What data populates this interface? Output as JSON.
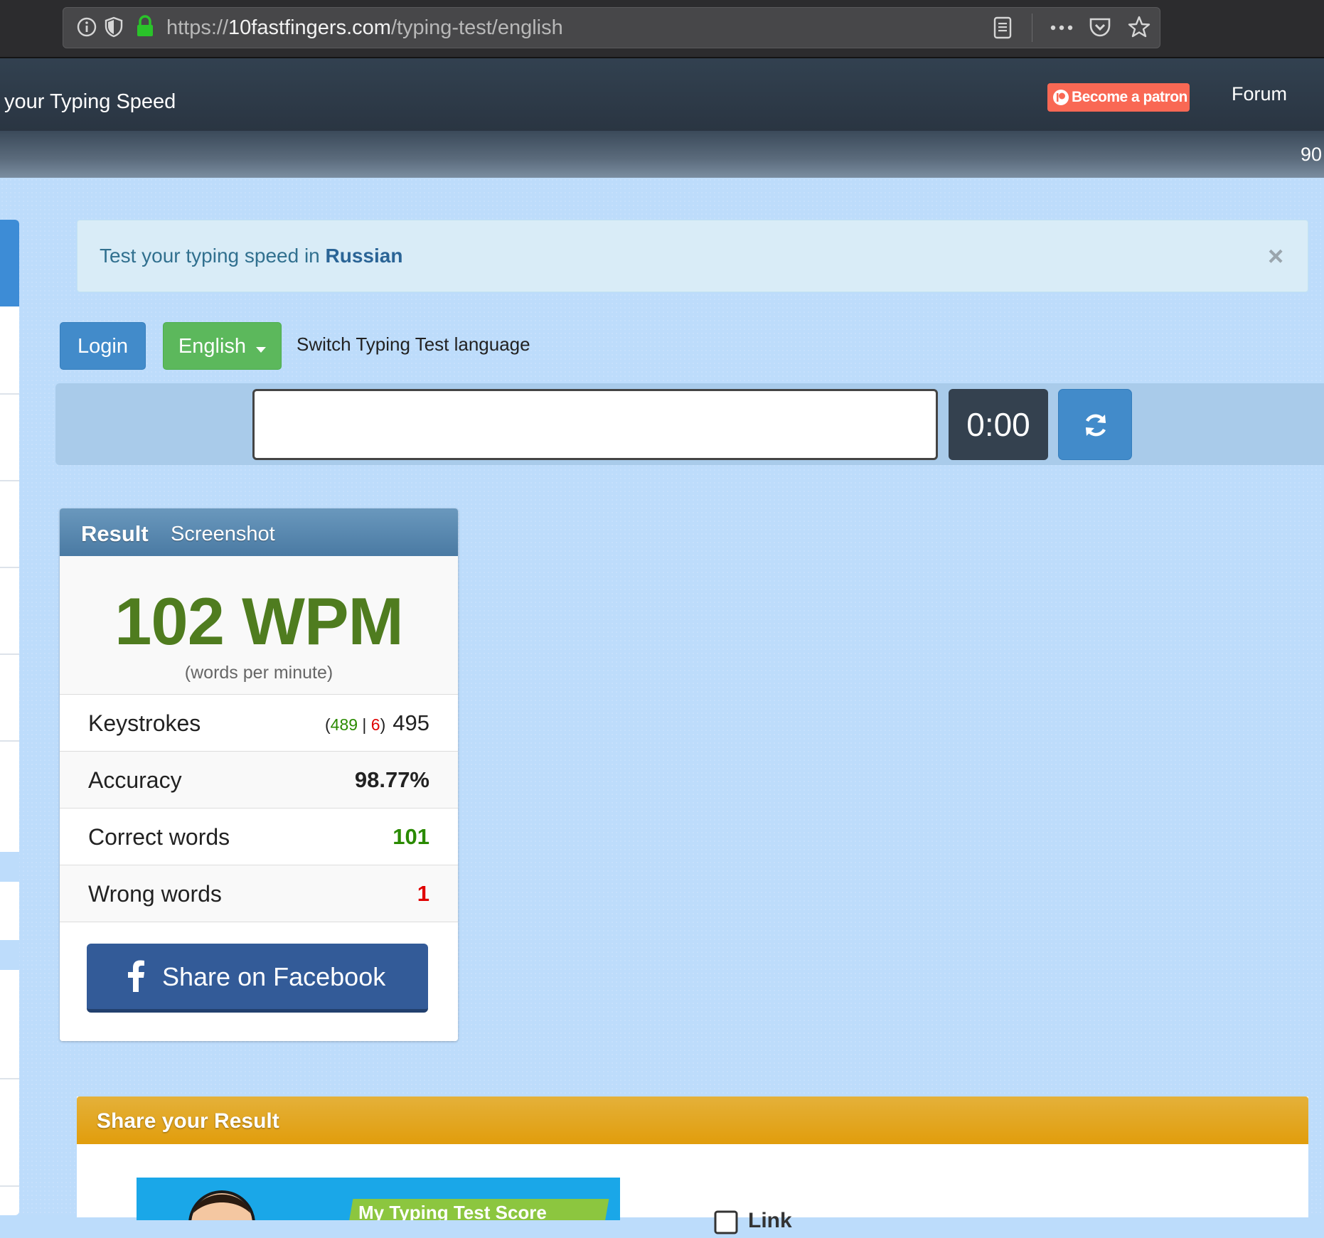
{
  "browser": {
    "url_scheme": "https://",
    "url_host": "10fastfingers.com",
    "url_path": "/typing-test/english"
  },
  "header": {
    "title": "your Typing Speed",
    "patron_label": "Become a patron",
    "forum_label": "Forum",
    "subbar_text": "90"
  },
  "alert": {
    "prefix": "Test your typing speed in ",
    "language_link": "Russian",
    "close": "×"
  },
  "controls": {
    "login_label": "Login",
    "language_label": "English",
    "switch_text": "Switch Typing Test language"
  },
  "typing": {
    "input_value": "",
    "timer": "0:00"
  },
  "result": {
    "tab_result": "Result",
    "tab_screenshot": "Screenshot",
    "wpm": "102 WPM",
    "wpm_caption": "(words per minute)",
    "keystrokes_label": "Keystrokes",
    "keystrokes_open": "(",
    "keystrokes_correct": "489",
    "keystrokes_sep": " | ",
    "keystrokes_wrong": "6",
    "keystrokes_close": ")",
    "keystrokes_total": "495",
    "accuracy_label": "Accuracy",
    "accuracy_value": "98.77%",
    "correct_label": "Correct words",
    "correct_value": "101",
    "wrong_label": "Wrong words",
    "wrong_value": "1",
    "facebook_label": "Share on Facebook"
  },
  "share": {
    "title": "Share your Result",
    "image_text": "My Typing Test Score",
    "link_text": "Link"
  },
  "colors": {
    "accent_blue": "#428bca",
    "success_green": "#5cb85c",
    "wpm_green": "#4f7c1f",
    "wrong_red": "#e00000",
    "patron_orange": "#f96854",
    "share_gold": "#e19d0c"
  }
}
